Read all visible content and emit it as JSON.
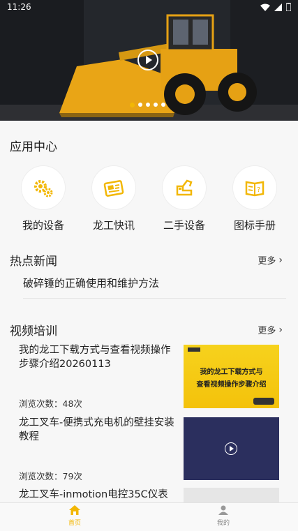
{
  "status": {
    "time": "11:26"
  },
  "banner": {
    "slide_count": 5,
    "active_index": 0
  },
  "apps": {
    "title": "应用中心",
    "items": [
      {
        "label": "我的设备",
        "icon": "gears-icon"
      },
      {
        "label": "龙工快讯",
        "icon": "newspaper-icon"
      },
      {
        "label": "二手设备",
        "icon": "excavator-icon"
      },
      {
        "label": "图标手册",
        "icon": "manual-book-icon"
      }
    ]
  },
  "news": {
    "title": "热点新闻",
    "more": "更多",
    "items": [
      {
        "title": "破碎锤的正确使用和维护方法"
      }
    ]
  },
  "videos": {
    "title": "视频培训",
    "more": "更多",
    "items": [
      {
        "title": "我的龙工下载方式与查看视频操作步骤介绍20260113",
        "views": "浏览次数：48次",
        "thumb_text_1": "我的龙工下载方式与",
        "thumb_text_2": "查看视频操作步骤介绍"
      },
      {
        "title": "龙工叉车-便携式充电机的壁挂安装教程",
        "views": "浏览次数：79次"
      },
      {
        "title": "龙工叉车-inmotion电控35C仪表",
        "views": ""
      }
    ]
  },
  "nav": {
    "items": [
      {
        "label": "首页",
        "active": true
      },
      {
        "label": "我的",
        "active": false
      }
    ]
  },
  "colors": {
    "accent": "#f2b705",
    "video_thumb_bg": "#2b2f5e"
  }
}
